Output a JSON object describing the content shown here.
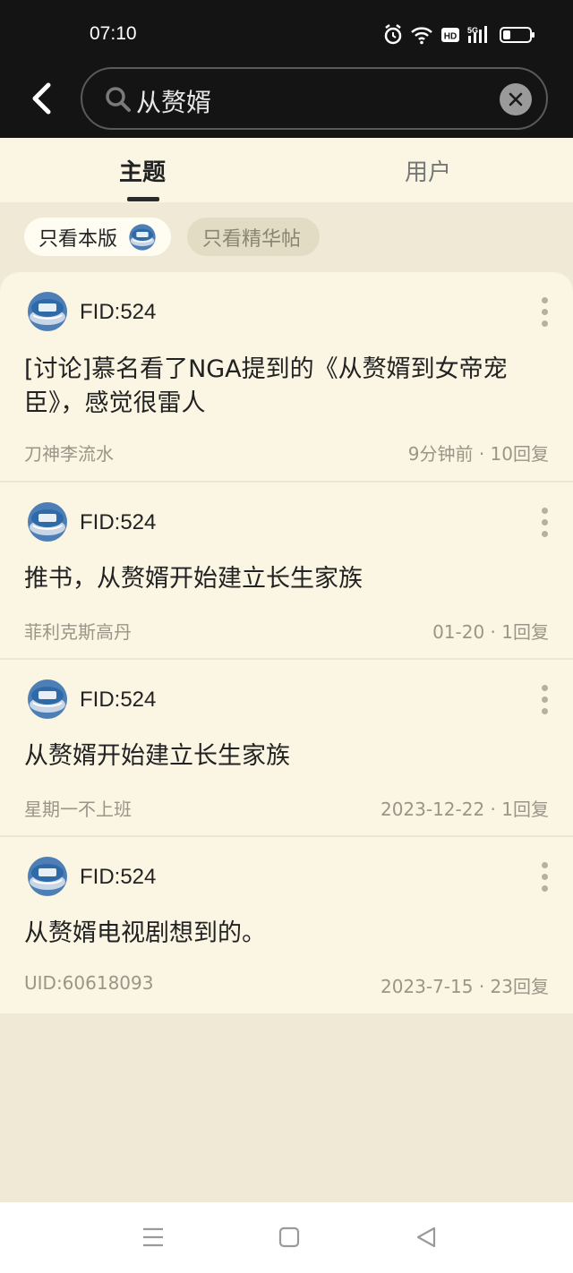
{
  "status_bar": {
    "time": "07:10",
    "icons": [
      "alarm-icon",
      "wifi-icon",
      "hd-icon",
      "5g-signal-icon",
      "battery-icon"
    ],
    "hd_label": "HD",
    "network_label": "5G"
  },
  "header": {
    "back_icon": "chevron-left-icon",
    "search_value": "从赘婿",
    "search_icon": "search-icon",
    "clear_icon": "close-icon"
  },
  "tabs": [
    {
      "label": "主题",
      "active": true
    },
    {
      "label": "用户",
      "active": false
    }
  ],
  "filters": {
    "board_only": "只看本版",
    "elite_only": "只看精华帖"
  },
  "posts": [
    {
      "forum": "FID:524",
      "title": "[讨论]慕名看了NGA提到的《从赘婿到女帝宠臣》，感觉很雷人",
      "author": "刀神李流水",
      "meta": "9分钟前 · 10回复"
    },
    {
      "forum": "FID:524",
      "title": "推书，从赘婿开始建立长生家族",
      "author": "菲利克斯高丹",
      "meta": "01-20 · 1回复"
    },
    {
      "forum": "FID:524",
      "title": "从赘婿开始建立长生家族",
      "author": "星期一不上班",
      "meta": "2023-12-22 · 1回复"
    },
    {
      "forum": "FID:524",
      "title": "从赘婿电视剧想到的。",
      "author": "UID:60618093",
      "meta": "2023-7-15 · 23回复"
    }
  ],
  "bottom_nav": [
    "menu-icon",
    "home-square-icon",
    "back-triangle-icon"
  ],
  "colors": {
    "header_bg": "#141414",
    "page_bg": "#efe9d6",
    "card_bg": "#faf6e3",
    "text_primary": "#222222",
    "text_secondary": "#9a9588"
  }
}
